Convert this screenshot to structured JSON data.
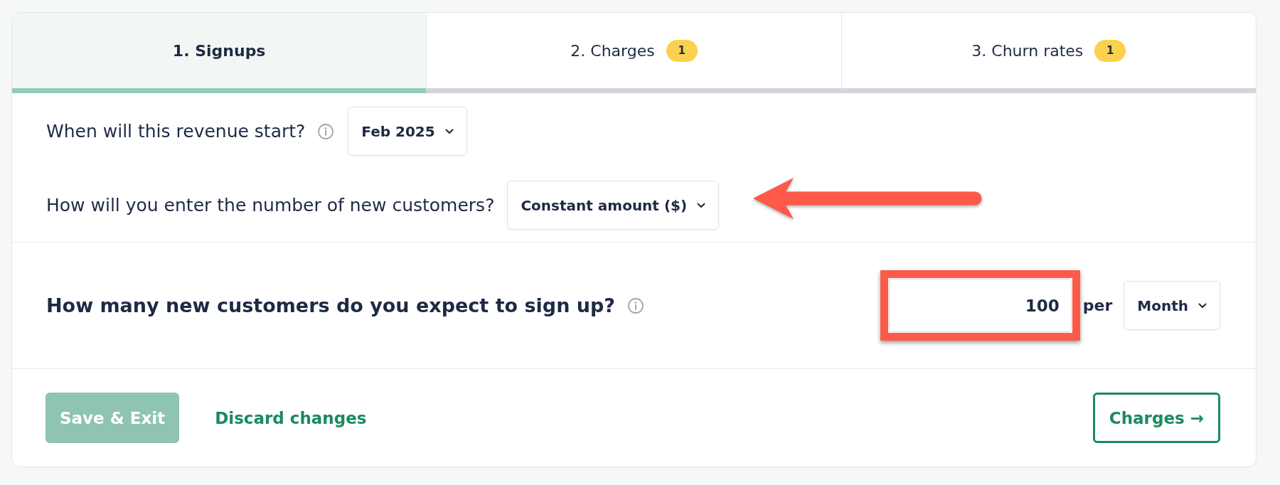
{
  "tabs": [
    {
      "label": "1. Signups",
      "selected": true
    },
    {
      "label": "2. Charges",
      "selected": false,
      "badge": "1"
    },
    {
      "label": "3. Churn rates",
      "selected": false,
      "badge": "1"
    }
  ],
  "questions": [
    {
      "label": "When will this revenue start?",
      "info": true,
      "dropdown": "Feb 2025",
      "arrow": false
    },
    {
      "label": "How will you enter the number of new customers?",
      "info": false,
      "dropdown": "Constant amount ($)",
      "arrow": true
    }
  ],
  "main_question": {
    "label": "How many new customers do you expect to sign up?",
    "info": true,
    "value": "100",
    "highlighted": true,
    "unit": "per",
    "period": "Month"
  },
  "footer": {
    "save_button": {
      "label": "Save & Exit",
      "disabled": true
    },
    "discard_link": "Discard changes",
    "next_button": "Charges →"
  }
}
